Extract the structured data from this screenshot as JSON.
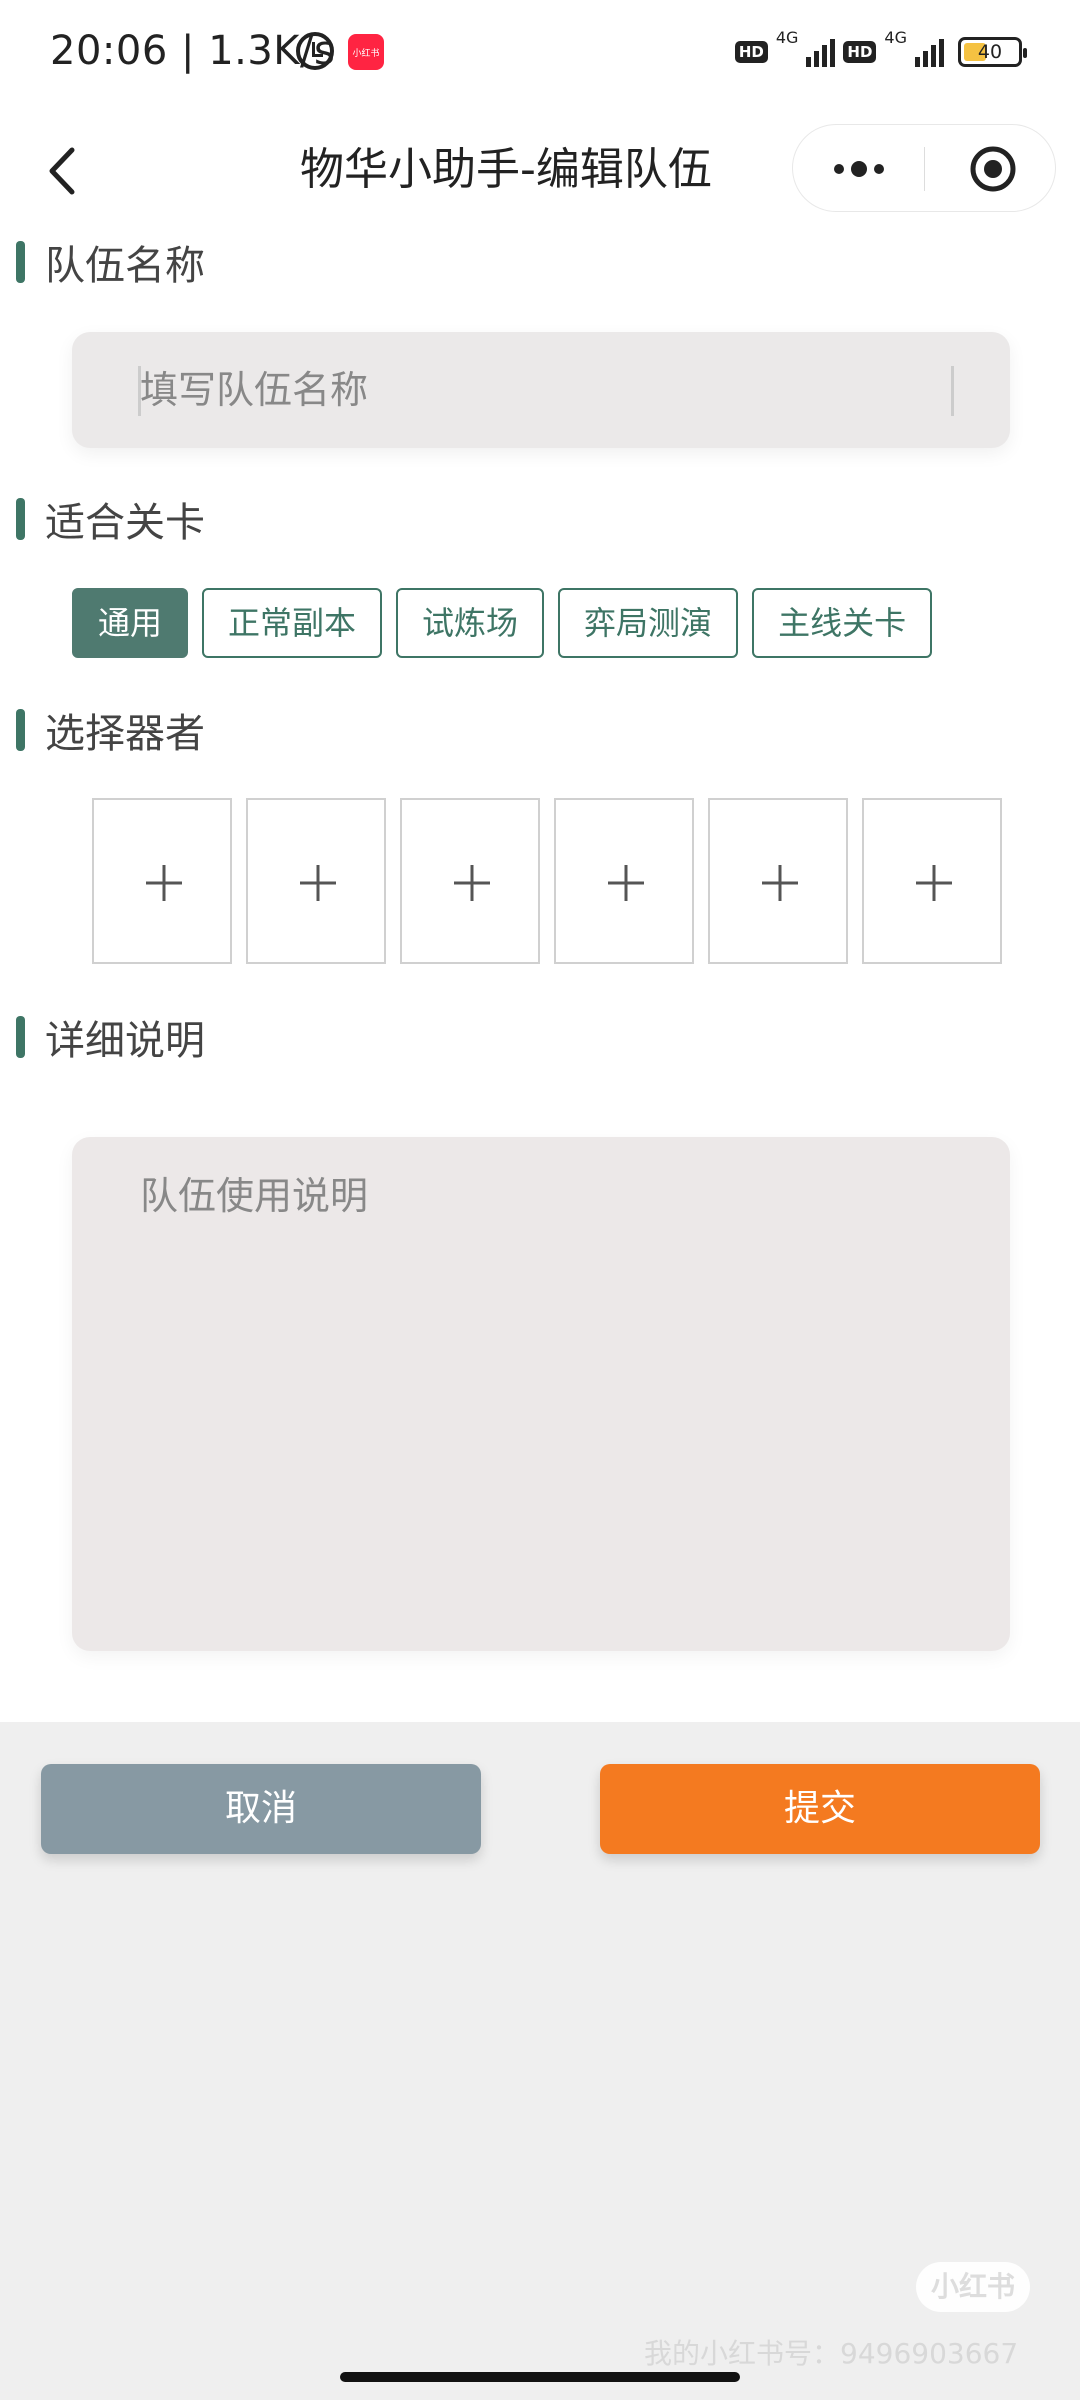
{
  "status_bar": {
    "time": "20:06",
    "speed": "| 1.3K/s",
    "app_badge": "小红书",
    "hd1": "HD",
    "hd2": "HD",
    "net1": "4G",
    "net2": "4G",
    "battery": "40"
  },
  "nav": {
    "title": "物华小助手-编辑队伍"
  },
  "sections": {
    "team_name": "队伍名称",
    "stages": "适合关卡",
    "choose_units": "选择器者",
    "details": "详细说明"
  },
  "team_name_input": {
    "placeholder": "填写队伍名称",
    "value": ""
  },
  "stage_tags": [
    {
      "label": "通用",
      "active": true
    },
    {
      "label": "正常副本",
      "active": false
    },
    {
      "label": "试炼场",
      "active": false
    },
    {
      "label": "弈局测演",
      "active": false
    },
    {
      "label": "主线关卡",
      "active": false
    }
  ],
  "unit_slots": [
    "add-icon",
    "add-icon",
    "add-icon",
    "add-icon",
    "add-icon",
    "add-icon"
  ],
  "description_input": {
    "placeholder": "队伍使用说明",
    "value": ""
  },
  "buttons": {
    "cancel": "取消",
    "submit": "提交"
  },
  "watermark": {
    "badge": "小红书",
    "text": "我的小红书号：9496903667"
  },
  "colors": {
    "accent": "#3e7565",
    "cancel": "#8799a3",
    "submit": "#f47a20"
  }
}
